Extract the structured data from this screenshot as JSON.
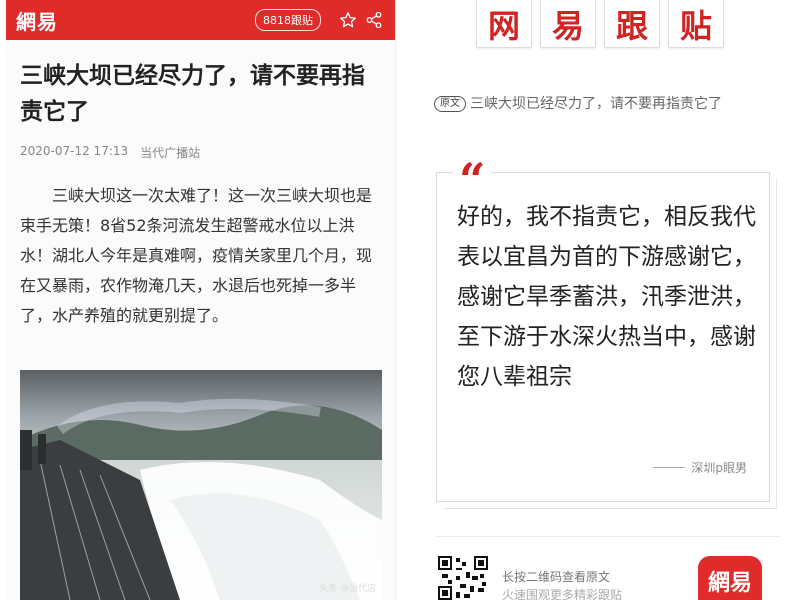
{
  "left_panel": {
    "topbar": {
      "logo": "網易",
      "badge": "8818跟贴",
      "icons": [
        "star-icon",
        "share-icon"
      ],
      "background": "#e02b2b"
    },
    "article": {
      "title": "三峡大坝已经尽力了，请不要再指责它了",
      "date": "2020-07-12 17:13",
      "source": "当代广播站",
      "body": "三峡大坝这一次太难了！这一次三峡大坝也是束手无策！8省52条河流发生超警戒水位以上洪水！湖北人今年是真难啊，疫情关家里几个月，现在又暴雨，农作物淹几天，水退后也死掉一多半了，水产养殖的就更别提了。",
      "image_caption": "头条 @当代店"
    }
  },
  "right_panel": {
    "brand_tiles": [
      "网",
      "易",
      "跟",
      "贴"
    ],
    "original_tag": "原文",
    "original_title": "三峡大坝已经尽力了，请不要再指责它了",
    "quote": {
      "mark": "“",
      "text": "好的，我不指责它，相反我代表以宜昌为首的下游感谢它，感谢它旱季蓄洪，汛季泄洪，至下游于水深火热当中，感谢您八辈祖宗",
      "author": "深圳p眼男"
    },
    "footer": {
      "qr_line1": "长按二维码查看原文",
      "qr_line2": "火速围观更多精彩跟贴",
      "app_icon_label": "網易"
    },
    "accent": "#d32222"
  }
}
